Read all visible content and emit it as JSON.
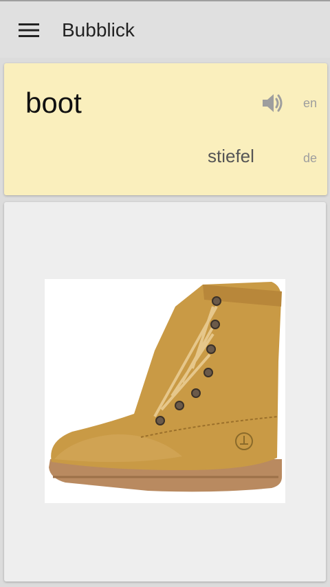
{
  "app": {
    "title": "Bubblick"
  },
  "icons": {
    "menu": "menu-icon",
    "speaker": "speaker-icon"
  },
  "word_card": {
    "word": "boot",
    "word_lang": "en",
    "translation": "stiefel",
    "translation_lang": "de"
  },
  "colors": {
    "toolbar": "#e0e0e0",
    "word_card_bg": "#faefbd",
    "image_card_bg": "#eeeeee",
    "boot": "#c99a45"
  }
}
